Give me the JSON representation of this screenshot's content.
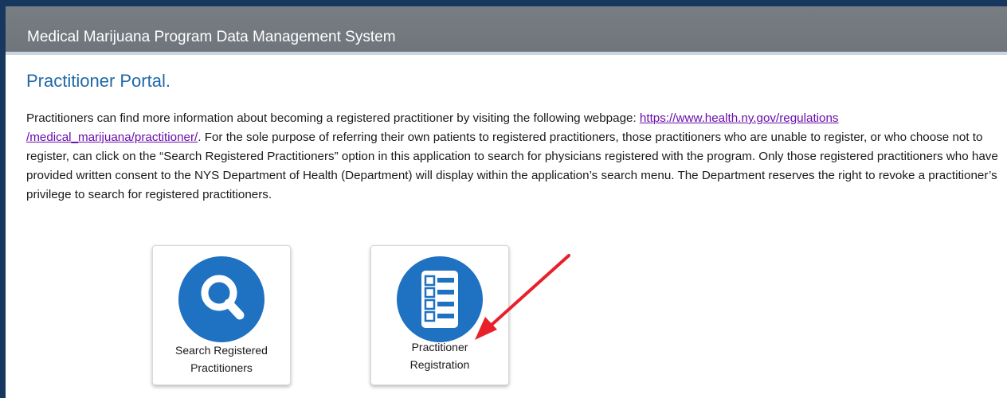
{
  "header": {
    "title": "Medical Marijuana Program Data Management System"
  },
  "page": {
    "heading": "Practitioner Portal.",
    "intro_before_link": "Practitioners can find more information about becoming a registered practitioner by visiting the following webpage: ",
    "link_line1": "https://www.health.ny.gov/regulations",
    "link_line2": "/medical_marijuana/practitioner/",
    "intro_after_link": ". For the sole purpose of referring their own patients to registered practitioners, those practitioners who are unable to register, or who choose not to register, can click on the “Search Registered Practitioners” option in this application to search for physicians registered with the program. Only those registered practitioners who have provided written consent to the NYS Department of Health (Department) will display within the application’s search menu. The Department reserves the right to revoke a practitioner’s privilege to search for registered practitioners."
  },
  "tiles": [
    {
      "line1": "Search Registered",
      "line2": "Practitioners",
      "icon": "magnifier-icon"
    },
    {
      "line1": "Practitioner",
      "line2": "Registration",
      "icon": "checklist-icon"
    }
  ],
  "colors": {
    "frame": "#17375e",
    "title_bar": "#75797f",
    "heading": "#2268a8",
    "icon_circle": "#1f71c2",
    "link": "#6a0dad",
    "annotation_arrow": "#e8202a"
  }
}
